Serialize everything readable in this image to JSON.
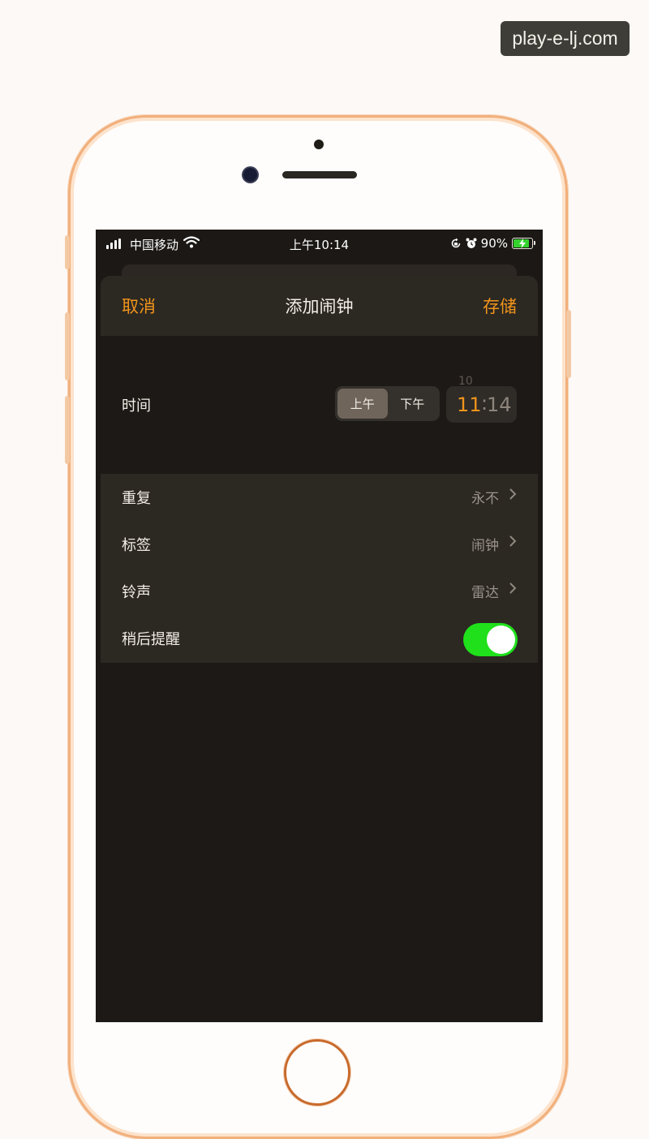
{
  "watermark": "play-e-lj.com",
  "status_bar": {
    "carrier": "中国移动",
    "time": "上午10:14",
    "battery": "90%",
    "battery_level": 0.9
  },
  "nav": {
    "cancel": "取消",
    "title": "添加闹钟",
    "save": "存储"
  },
  "time": {
    "label": "时间",
    "am": "上午",
    "pm": "下午",
    "selected": "上午",
    "hour": "11",
    "minute": "14",
    "hour_above": "10"
  },
  "settings": {
    "repeat": {
      "label": "重复",
      "value": "永不"
    },
    "label": {
      "label": "标签",
      "value": "闹钟"
    },
    "sound": {
      "label": "铃声",
      "value": "雷达"
    },
    "snooze": {
      "label": "稍后提醒",
      "enabled": true
    }
  },
  "colors": {
    "accent": "#f0941c",
    "toggle_on": "#1fe01b",
    "battery_fill": "#35d12e"
  }
}
